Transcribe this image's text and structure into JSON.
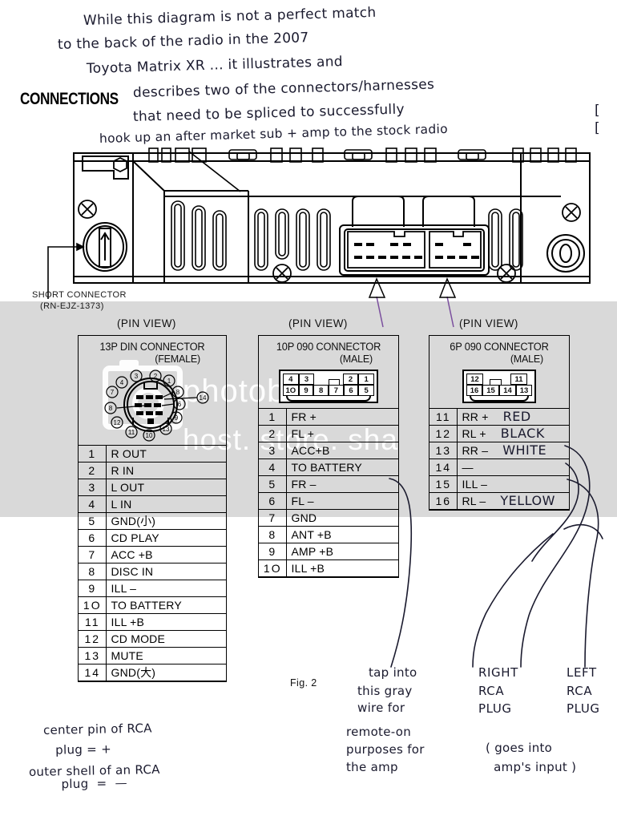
{
  "page": {
    "heading": "CONNECTIONS",
    "figure_label": "Fig. 2"
  },
  "handwritten_top": [
    "While this diagram is not a perfect match",
    "to the back of the radio in the 2007",
    "Toyota Matrix XR ... it illustrates and",
    "describes two of the connectors/harnesses",
    "that need to be spliced to successfully",
    "hook up an after market sub + amp to the stock radio"
  ],
  "radio": {
    "short_connector_label": "SHORT CONNECTOR",
    "short_connector_part": "(RN-EJZ-1373)"
  },
  "pin_view_label": "(PIN  VIEW)",
  "connectors": [
    {
      "title": "13P DIN CONNECTOR",
      "gender": "(FEMALE)",
      "face_type": "din",
      "face_callouts": [
        "3",
        "2",
        "1",
        "4",
        "8",
        "7",
        "6",
        "8",
        "9",
        "12",
        "14",
        "11",
        "13",
        "10"
      ],
      "rows": [
        {
          "pin": "1",
          "label": "R OUT",
          "note": ""
        },
        {
          "pin": "2",
          "label": "R IN",
          "note": ""
        },
        {
          "pin": "3",
          "label": "L OUT",
          "note": ""
        },
        {
          "pin": "4",
          "label": "L IN",
          "note": ""
        },
        {
          "pin": "5",
          "label": "GND(小)",
          "note": ""
        },
        {
          "pin": "6",
          "label": "CD PLAY",
          "note": ""
        },
        {
          "pin": "7",
          "label": "ACC +B",
          "note": ""
        },
        {
          "pin": "8",
          "label": "DISC IN",
          "note": ""
        },
        {
          "pin": "9",
          "label": "ILL –",
          "note": ""
        },
        {
          "pin": "1O",
          "label": "TO BATTERY",
          "note": ""
        },
        {
          "pin": "11",
          "label": "ILL +B",
          "note": ""
        },
        {
          "pin": "12",
          "label": "CD MODE",
          "note": ""
        },
        {
          "pin": "13",
          "label": "MUTE",
          "note": ""
        },
        {
          "pin": "14",
          "label": "GND(大)",
          "note": ""
        }
      ]
    },
    {
      "title": "10P 090 CONNECTOR",
      "gender": "(MALE)",
      "face_type": "box",
      "face_top": [
        "4",
        "3",
        "",
        "2",
        "1"
      ],
      "face_bottom": [
        "1O",
        "9",
        "8",
        "7",
        "6",
        "5"
      ],
      "rows": [
        {
          "pin": "1",
          "label": "FR +",
          "note": ""
        },
        {
          "pin": "2",
          "label": "FL +",
          "note": ""
        },
        {
          "pin": "3",
          "label": "ACC+B",
          "note": ""
        },
        {
          "pin": "4",
          "label": "TO BATTERY",
          "note": ""
        },
        {
          "pin": "5",
          "label": "FR –",
          "note": ""
        },
        {
          "pin": "6",
          "label": "FL –",
          "note": ""
        },
        {
          "pin": "7",
          "label": "GND",
          "note": ""
        },
        {
          "pin": "8",
          "label": "ANT +B",
          "note": ""
        },
        {
          "pin": "9",
          "label": "AMP +B",
          "note": ""
        },
        {
          "pin": "1O",
          "label": "ILL +B",
          "note": ""
        }
      ]
    },
    {
      "title": "6P 090 CONNECTOR",
      "gender": "(MALE)",
      "face_type": "box",
      "face_top": [
        "12",
        "",
        "11"
      ],
      "face_bottom": [
        "16",
        "15",
        "14",
        "13"
      ],
      "rows": [
        {
          "pin": "11",
          "label": "RR +",
          "note": "RED"
        },
        {
          "pin": "12",
          "label": "RL +",
          "note": "BLACK"
        },
        {
          "pin": "13",
          "label": "RR –",
          "note": "WHITE"
        },
        {
          "pin": "14",
          "label": "—",
          "note": ""
        },
        {
          "pin": "15",
          "label": "ILL –",
          "note": ""
        },
        {
          "pin": "16",
          "label": "RL –",
          "note": "YELLOW"
        }
      ]
    }
  ],
  "handwritten_notes": {
    "tap_into": [
      "tap into",
      "this gray",
      "wire for",
      "remote-on",
      "purposes for",
      "the amp"
    ],
    "right_rca": [
      "RIGHT",
      "RCA",
      "PLUG"
    ],
    "left_rca": [
      "LEFT",
      "RCA",
      "PLUG"
    ],
    "goes_into": [
      "( goes into",
      "  amp's input )"
    ],
    "rca_polarity": [
      "center pin of RCA",
      "   plug = +",
      "outer shell of an RCA",
      "        plug  =  —"
    ]
  },
  "watermark": {
    "text_left": "photobucket",
    "text_right": "host. store. sha"
  },
  "colors": {
    "ink": "#1a1a2e",
    "print": "#000000",
    "watermark_band": "#d9d9d9"
  }
}
